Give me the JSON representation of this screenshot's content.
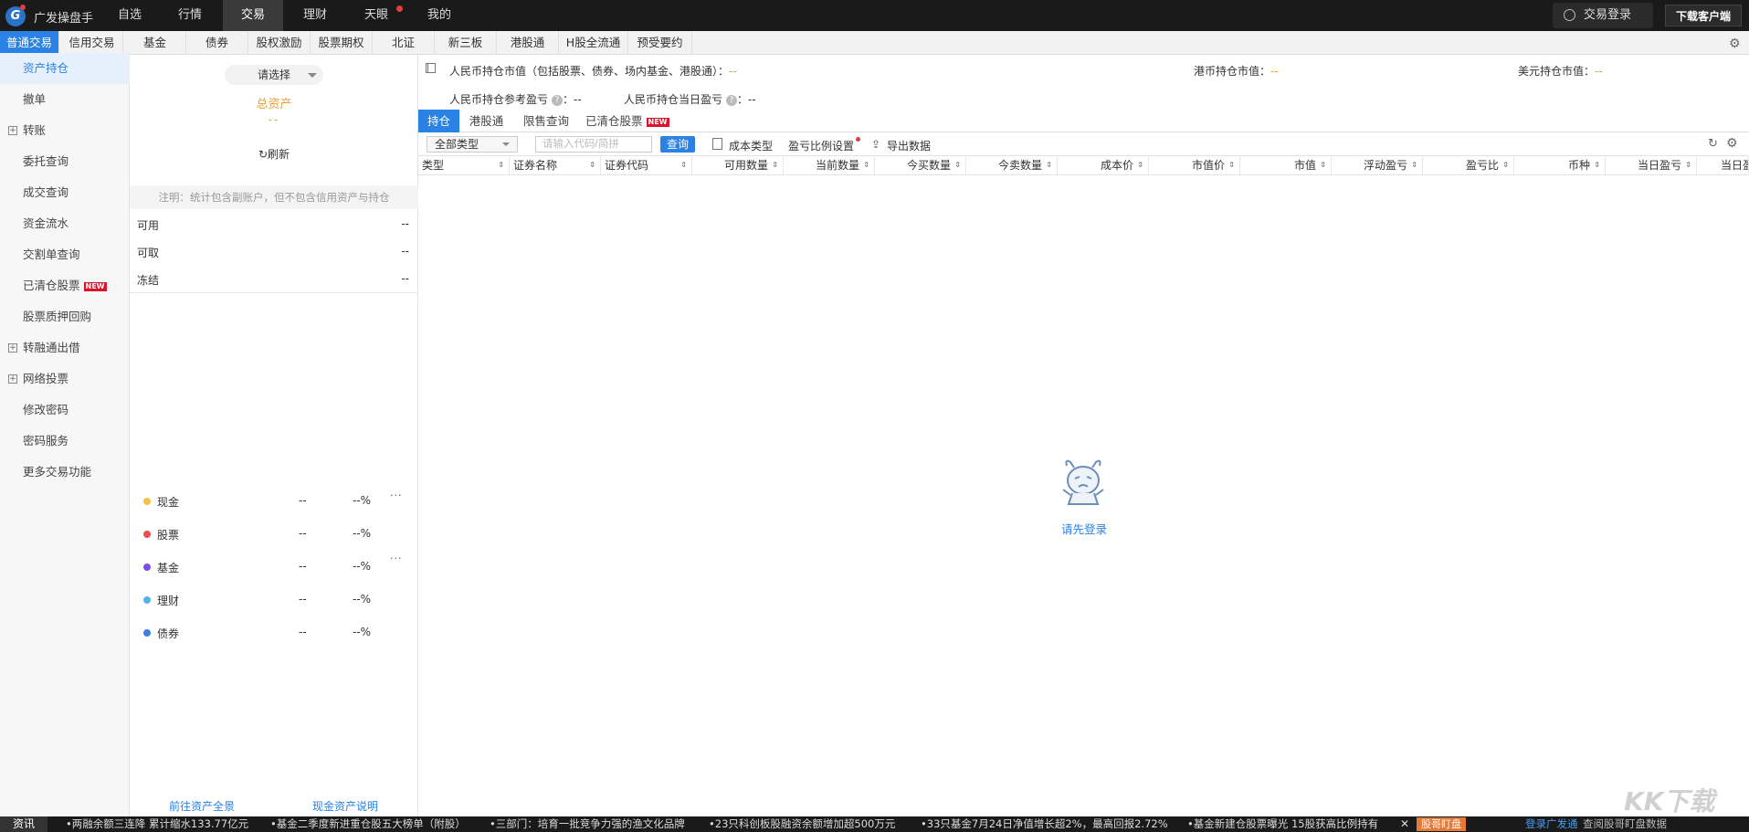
{
  "app": {
    "logo_glyph": "G",
    "name": "广发操盘手"
  },
  "topnav": {
    "items": [
      "自选",
      "行情",
      "交易",
      "理财",
      "天眼",
      "我的"
    ],
    "active": "交易",
    "login_label": "交易登录",
    "download_label": "下载客户端"
  },
  "subtabs": [
    "普通交易",
    "信用交易",
    "基金",
    "债券",
    "股权激励",
    "股票期权",
    "北证",
    "新三板",
    "港股通",
    "H股全流通",
    "预受要约"
  ],
  "leftnav": {
    "items": [
      "资产持仓",
      "撤单",
      "转账",
      "委托查询",
      "成交查询",
      "资金流水",
      "交割单查询",
      "已清仓股票",
      "股票质押回购",
      "转融通出借",
      "网络投票",
      "修改密码",
      "密码服务",
      "更多交易功能"
    ],
    "new_badge": "NEW"
  },
  "asset": {
    "select_label": "请选择",
    "total_label": "总资产",
    "total_value": "--",
    "refresh_label": "刷新",
    "note": "注明：统计包含副账户，但不包含信用资产与持仓",
    "rows": [
      {
        "label": "可用",
        "value": "--"
      },
      {
        "label": "可取",
        "value": "--"
      },
      {
        "label": "冻结",
        "value": "--"
      }
    ],
    "categories": [
      {
        "name": "现金",
        "value": "--",
        "pct": "--%",
        "color": "#f6c046"
      },
      {
        "name": "股票",
        "value": "--",
        "pct": "--%",
        "color": "#ee4b4b"
      },
      {
        "name": "基金",
        "value": "--",
        "pct": "--%",
        "color": "#7b4de8"
      },
      {
        "name": "理财",
        "value": "--",
        "pct": "--%",
        "color": "#4fb3f0"
      },
      {
        "name": "债券",
        "value": "--",
        "pct": "--%",
        "color": "#3b7fe6"
      }
    ],
    "more_glyph": "···",
    "link_overview": "前往资产全景",
    "link_cash": "现金资产说明"
  },
  "summary": {
    "rmb_market_label": "人民币持仓市值（包括股票、债券、场内基金、港股通）：",
    "rmb_market_value": "--",
    "hkd_market_label": "港币持仓市值：",
    "hkd_market_value": "--",
    "usd_market_label": "美元持仓市值：",
    "usd_market_value": "--",
    "rmb_ref_pl_label": "人民币持仓参考盈亏",
    "rmb_ref_pl_value": "--",
    "rmb_day_pl_label": "人民币持仓当日盈亏",
    "rmb_day_pl_value": "--",
    "q_glyph": "?"
  },
  "maintabs": [
    "持仓",
    "港股通",
    "限售查询",
    "已清仓股票"
  ],
  "toolbar": {
    "type_select": "全部类型",
    "code_placeholder": "请输入代码/简拼",
    "query_label": "查询",
    "cost_type_label": "成本类型",
    "pl_ratio_label": "盈亏比例设置",
    "export_label": "导出数据"
  },
  "table": {
    "columns": [
      "类型",
      "证券名称",
      "证券代码",
      "可用数量",
      "当前数量",
      "今买数量",
      "今卖数量",
      "成本价",
      "市值价",
      "市值",
      "浮动盈亏",
      "盈亏比",
      "币种",
      "当日盈亏",
      "当日盈"
    ],
    "sort_glyph": "⇕"
  },
  "empty": {
    "text": "请先登录"
  },
  "ticker": {
    "label": "资讯",
    "items": [
      "•两融余额三连降 累计缩水133.77亿元",
      "•基金二季度新进重仓股五大榜单（附股）",
      "•三部门：培育一批竞争力强的渔文化品牌",
      "•23只科创板股融资余额增加超500万元",
      "•33只基金7月24日净值增长超2%，最高回报2.72%",
      "•基金新建仓股票曝光 15股获高比例持有"
    ],
    "close_glyph": "✕",
    "stock_watch": "股哥盯盘",
    "login_link": "登录广发通",
    "login_rest": "查阅股哥盯盘数据"
  },
  "watermark": "KK下载",
  "colors": {
    "accent": "#2a82e4",
    "orange": "#e8a23a",
    "topbar": "#1a1a1a",
    "new_badge": "#d9142b"
  }
}
